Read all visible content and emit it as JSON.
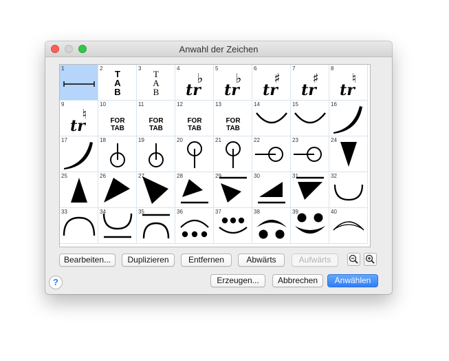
{
  "window": {
    "title": "Anwahl der Zeichen"
  },
  "grid": {
    "selected_index": 1,
    "cells": [
      {
        "num": "1",
        "symbol": "bracket-line-icon"
      },
      {
        "num": "2",
        "symbol": "tab-clef-bold-icon",
        "text": [
          "T",
          "A",
          "B"
        ]
      },
      {
        "num": "3",
        "symbol": "tab-clef-serif-icon",
        "text": [
          "T",
          "A",
          "B"
        ]
      },
      {
        "num": "4",
        "symbol": "trill-flat-icon",
        "text": [
          "tr",
          "♭"
        ]
      },
      {
        "num": "5",
        "symbol": "trill-flat-icon",
        "text": [
          "tr",
          "♭"
        ]
      },
      {
        "num": "6",
        "symbol": "trill-sharp-icon",
        "text": [
          "tr",
          "♯"
        ]
      },
      {
        "num": "7",
        "symbol": "trill-sharp-icon",
        "text": [
          "tr",
          "♯"
        ]
      },
      {
        "num": "8",
        "symbol": "trill-natural-icon",
        "text": [
          "tr",
          "♮"
        ]
      },
      {
        "num": "9",
        "symbol": "trill-natural-icon",
        "text": [
          "tr",
          "♮"
        ]
      },
      {
        "num": "10",
        "symbol": "for-tab-icon",
        "text": [
          "FOR",
          "TAB"
        ]
      },
      {
        "num": "11",
        "symbol": "for-tab-icon",
        "text": [
          "FOR",
          "TAB"
        ]
      },
      {
        "num": "12",
        "symbol": "for-tab-icon",
        "text": [
          "FOR",
          "TAB"
        ]
      },
      {
        "num": "13",
        "symbol": "for-tab-icon",
        "text": [
          "FOR",
          "TAB"
        ]
      },
      {
        "num": "14",
        "symbol": "arc-down-icon"
      },
      {
        "num": "15",
        "symbol": "arc-down-icon"
      },
      {
        "num": "16",
        "symbol": "curve-thick-upper-icon"
      },
      {
        "num": "17",
        "symbol": "curve-thick-lower-icon"
      },
      {
        "num": "18",
        "symbol": "circle-stem-up-icon"
      },
      {
        "num": "19",
        "symbol": "circle-stem-up-icon"
      },
      {
        "num": "20",
        "symbol": "circle-stem-down-icon"
      },
      {
        "num": "21",
        "symbol": "circle-stem-down-icon"
      },
      {
        "num": "22",
        "symbol": "circle-stem-left-icon"
      },
      {
        "num": "23",
        "symbol": "circle-stem-left-icon"
      },
      {
        "num": "24",
        "symbol": "wedge-down-icon"
      },
      {
        "num": "25",
        "symbol": "wedge-up-icon"
      },
      {
        "num": "26",
        "symbol": "wedge-up-right-icon"
      },
      {
        "num": "27",
        "symbol": "wedge-down-right-icon"
      },
      {
        "num": "28",
        "symbol": "wedge-up-right-bar-icon"
      },
      {
        "num": "29",
        "symbol": "wedge-down-right-bar-icon"
      },
      {
        "num": "30",
        "symbol": "wedge-right-bar-icon"
      },
      {
        "num": "31",
        "symbol": "wedge-left-bar-icon"
      },
      {
        "num": "32",
        "symbol": "arc-down-small-icon"
      },
      {
        "num": "33",
        "symbol": "arc-up-icon"
      },
      {
        "num": "34",
        "symbol": "arc-down-bar-icon"
      },
      {
        "num": "35",
        "symbol": "arc-up-bar-icon"
      },
      {
        "num": "36",
        "symbol": "arc-up-dots-icon"
      },
      {
        "num": "37",
        "symbol": "arc-down-dots-icon"
      },
      {
        "num": "38",
        "symbol": "arc-up-two-dots-icon"
      },
      {
        "num": "39",
        "symbol": "arc-down-two-dots-icon"
      },
      {
        "num": "40",
        "symbol": "lens-arc-icon"
      }
    ]
  },
  "buttons": {
    "edit": "Bearbeiten...",
    "duplicate": "Duplizieren",
    "remove": "Entfernen",
    "down": "Abwärts",
    "up": "Aufwärts",
    "create": "Erzeugen...",
    "cancel": "Abbrechen",
    "select": "Anwählen",
    "help": "?"
  },
  "icons": {
    "zoom_out": "zoom-out-icon",
    "zoom_in": "zoom-in-icon"
  },
  "colors": {
    "selection": "#b5d5fb",
    "accent": "#2f7ef5",
    "close": "#fc5f57",
    "minimize": "#d3d3d3",
    "maximize": "#33c748"
  }
}
